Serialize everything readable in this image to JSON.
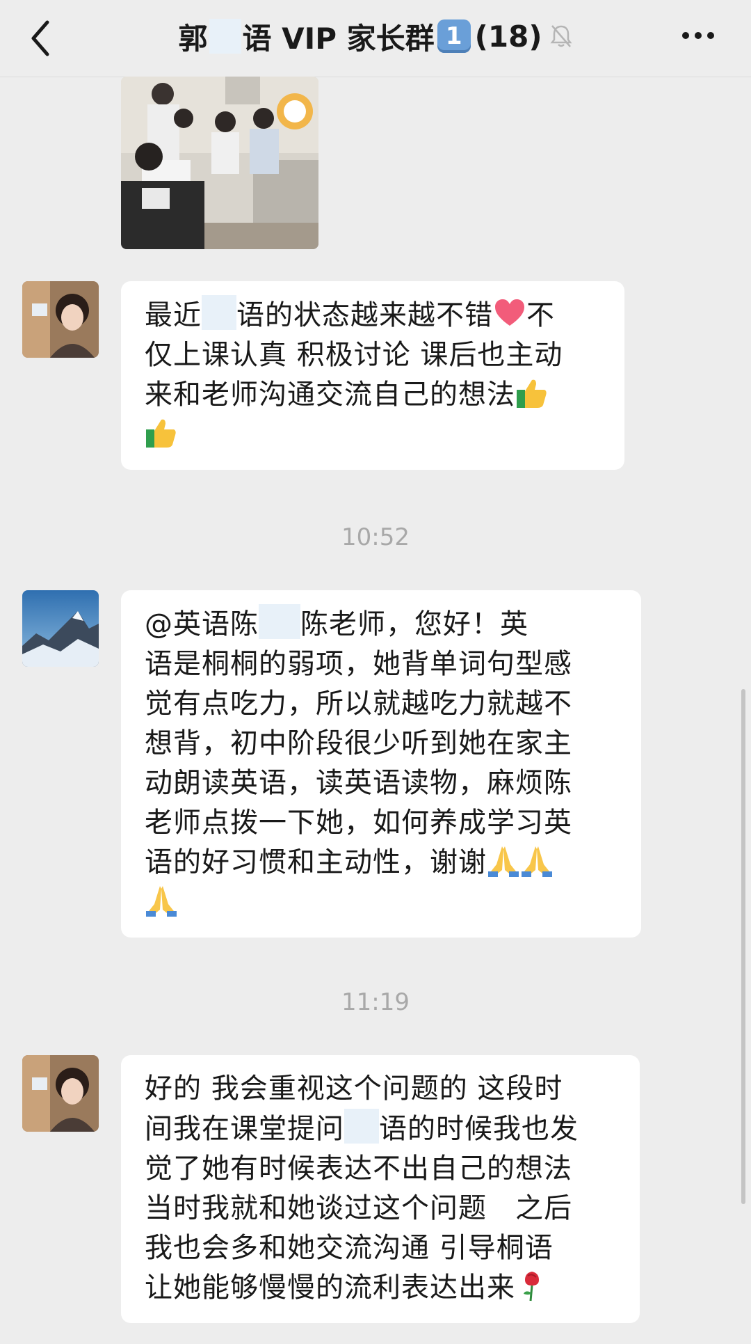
{
  "header": {
    "title_part1": "郭",
    "title_part2": "语 VIP 家长群",
    "badge": "1",
    "member_count": "(18)"
  },
  "messages": [
    {
      "line1": "最近",
      "line1b": "语的状态越来越不错",
      "line1c": "不",
      "line2": "仅上课认真 积极讨论 课后也主动",
      "line3": "来和老师沟通交流自己的想法"
    },
    {
      "line1a": "@英语陈",
      "line1b": "陈老师，您好！英",
      "line2": "语是桐桐的弱项，她背单词句型感",
      "line3": "觉有点吃力，所以就越吃力就越不",
      "line4": "想背，初中阶段很少听到她在家主",
      "line5": "动朗读英语，读英语读物，麻烦陈",
      "line6": "老师点拨一下她，如何养成学习英",
      "line7": "语的好习惯和主动性，谢谢"
    },
    {
      "line1": "好的 我会重视这个问题的 这段时",
      "line2a": "间我在课堂提问",
      "line2b": "语的时候我也发",
      "line3": "觉了她有时候表达不出自己的想法",
      "line4": "当时我就和她谈过这个问题   之后",
      "line5": "我也会多和她交流沟通 引导桐语",
      "line6": "让她能够慢慢的流利表达出来"
    }
  ],
  "timestamps": [
    "10:52",
    "11:19"
  ],
  "colors": {
    "background": "#ededed",
    "bubble": "#ffffff",
    "timestamp": "#a8a8a8"
  }
}
